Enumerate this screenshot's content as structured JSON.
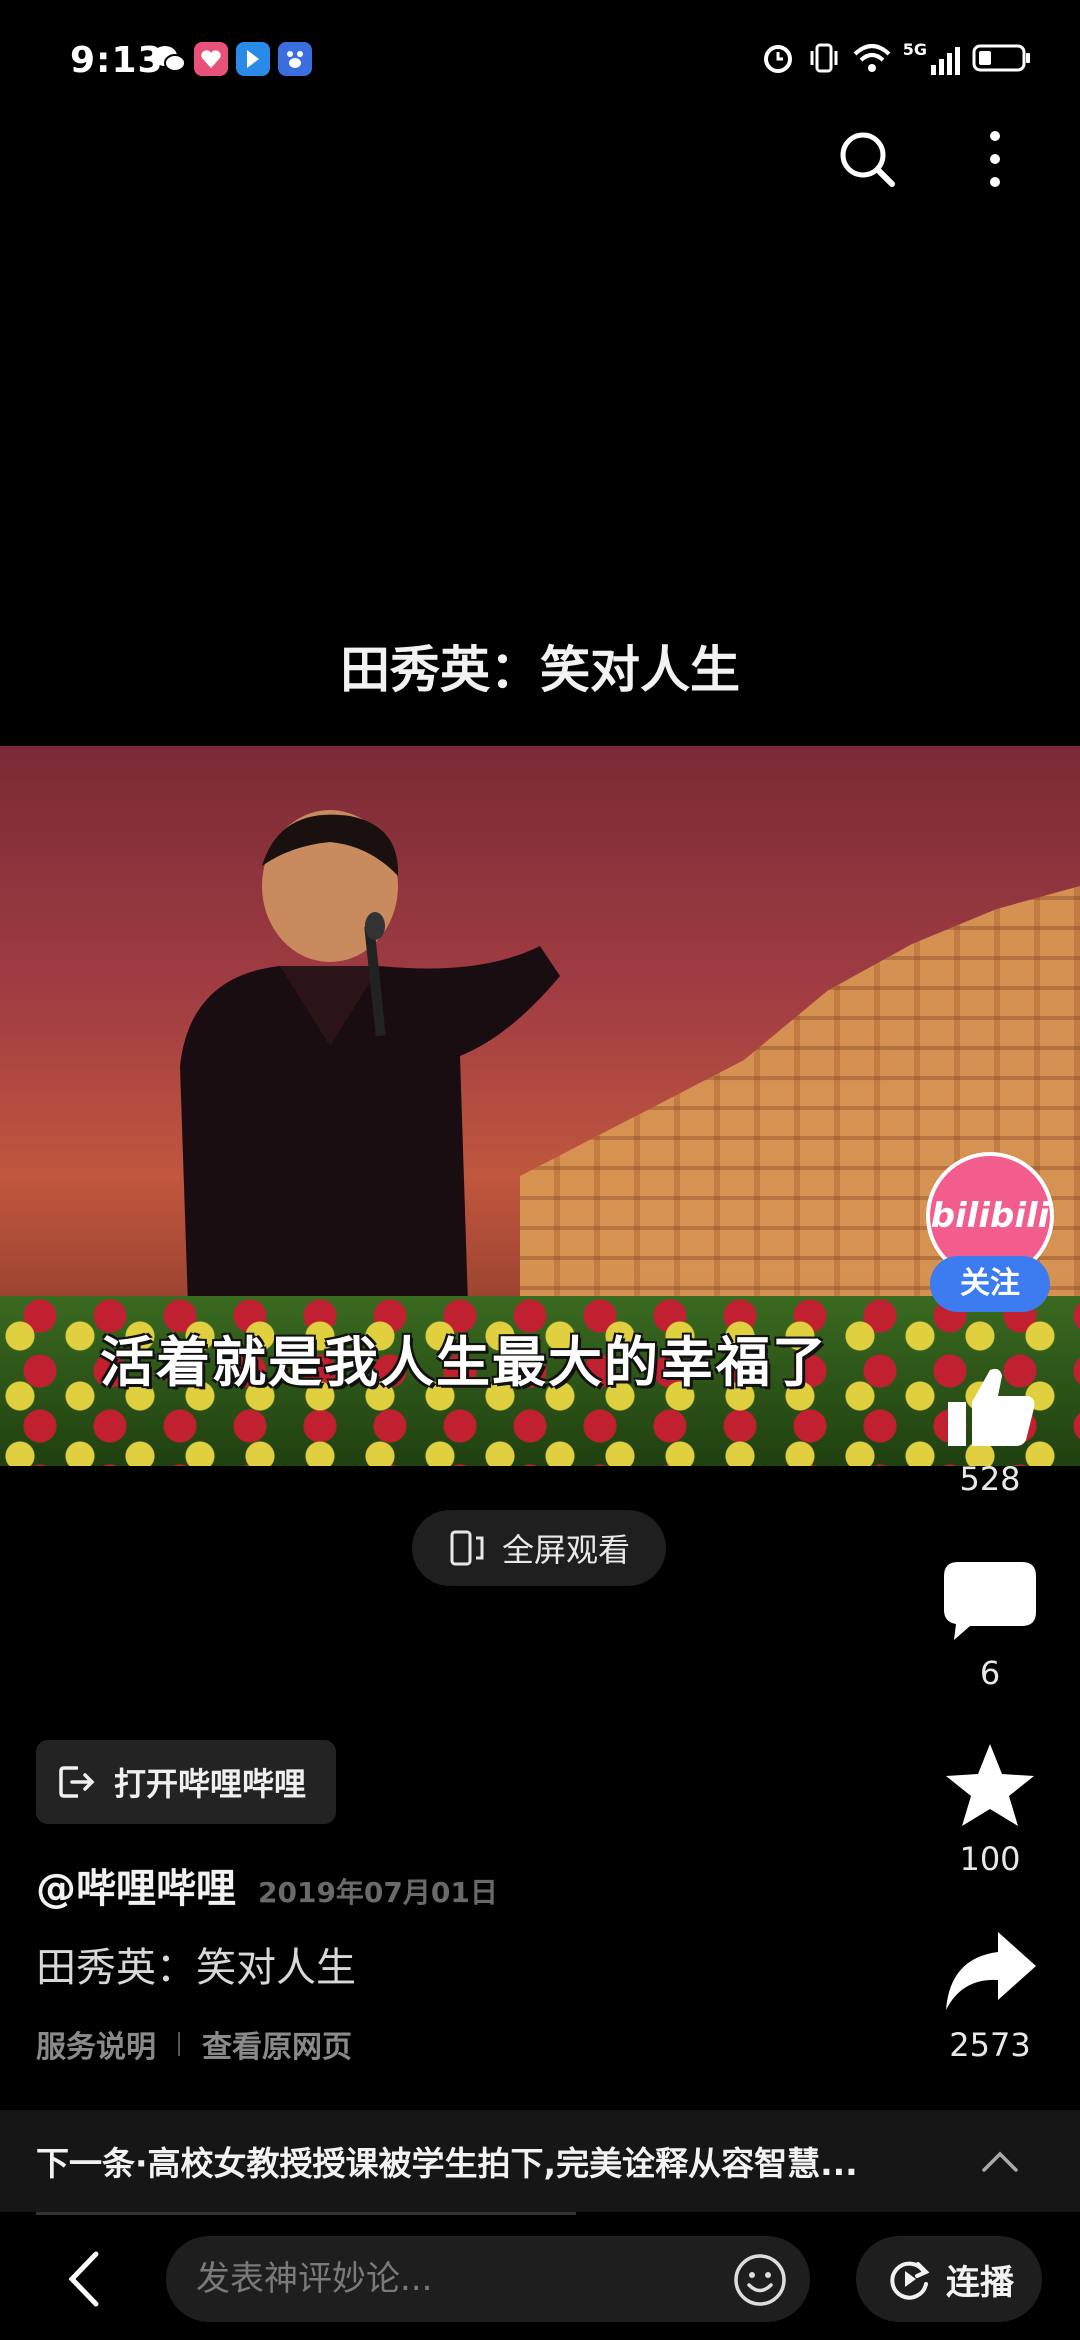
{
  "status_bar": {
    "time": "9:13",
    "network": "5G",
    "apps": [
      "wechat-icon",
      "app-heart-icon",
      "bookmark-app-icon",
      "baidu-icon"
    ]
  },
  "video": {
    "title": "田秀英：笑对人生",
    "subtitle": "活着就是我人生最大的幸福了"
  },
  "channel": {
    "avatar_text": "bilibili",
    "follow_label": "关注"
  },
  "actions": {
    "likes": "528",
    "comments": "6",
    "favorites": "100",
    "shares": "2573"
  },
  "fullscreen_label": "全屏观看",
  "open_app_label": "打开哔哩哔哩",
  "post": {
    "author": "@哔哩哔哩",
    "date": "2019年07月01日",
    "description": "田秀英：笑对人生",
    "link_service": "服务说明",
    "link_original": "查看原网页"
  },
  "next": {
    "text": "下一条·高校女教授授课被学生拍下,完美诠释从容智慧..."
  },
  "bottom": {
    "comment_placeholder": "发表神评妙论...",
    "autoplay_label": "连播"
  },
  "colors": {
    "accent_blue": "#3c7cf0",
    "bilibili_pink": "#f25d8e",
    "background": "#000000"
  }
}
